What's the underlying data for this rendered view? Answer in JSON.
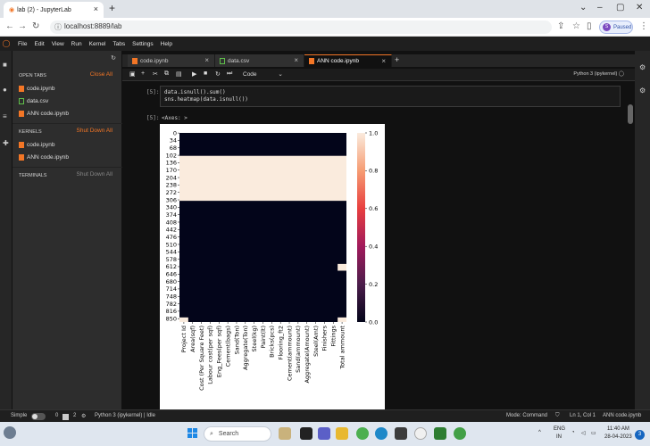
{
  "browser": {
    "tab_title": "lab (2) - JupyterLab",
    "url": "localhost:8889/lab",
    "paused_label": "Paused",
    "avatar_letter": "S"
  },
  "menu": [
    "File",
    "Edit",
    "View",
    "Run",
    "Kernel",
    "Tabs",
    "Settings",
    "Help"
  ],
  "sidebar": {
    "open_tabs_title": "OPEN TABS",
    "close_all": "Close All",
    "open_tabs": [
      "code.ipynb",
      "data.csv",
      "ANN code.ipynb"
    ],
    "kernels_title": "KERNELS",
    "shut_down_all": "Shut Down All",
    "kernels": [
      "code.ipynb",
      "ANN code.ipynb"
    ],
    "terminals_title": "TERMINALS",
    "terminals_shut_down_all": "Shut Down All"
  },
  "doc_tabs": [
    "code.ipynb",
    "data.csv",
    "ANN code.ipynb"
  ],
  "toolbar": {
    "cell_type": "Code",
    "kernel": "Python 3 (ipykernel)"
  },
  "cell": {
    "in_prompt": "[5]:",
    "code_line1": "data.isnull().sum()",
    "code_line2": "sns.heatmap(data.isnull())",
    "out_prompt": "[5]:",
    "out_text": "<Axes: >"
  },
  "chart_data": {
    "type": "heatmap",
    "y_ticks": [
      "0",
      "34",
      "68",
      "102",
      "136",
      "170",
      "204",
      "238",
      "272",
      "306",
      "340",
      "374",
      "408",
      "442",
      "476",
      "510",
      "544",
      "578",
      "612",
      "646",
      "680",
      "714",
      "748",
      "782",
      "816",
      "850"
    ],
    "x_ticks": [
      "Project Id",
      "Area(sqf)",
      "Cost (Per Square Feet)",
      "Labour cost(per sqf)",
      "Eng_Fees(per sqf)",
      "Cement(bags)",
      "Sand(Ton)",
      "Aggregate(Ton)",
      "Steel(kg)",
      "Paint(lt)",
      "Bricks(pcs)",
      "Flooring_ft2",
      "Cement(ammount)",
      "Sand(ammount)",
      "Aggregate(Amount)",
      "Steel(Amt)",
      "Finishers",
      "Fittings",
      "Total ammount"
    ],
    "colorbar_ticks": [
      "1.0",
      "0.8",
      "0.6",
      "0.4",
      "0.2",
      "0.0"
    ],
    "row_count": 866,
    "row_range": [
      0,
      865
    ],
    "missing_blocks": [
      {
        "rows": [
          105,
          310
        ],
        "columns": "all",
        "value": 1
      },
      {
        "rows": [
          600,
          630
        ],
        "columns": [
          "Total ammount"
        ],
        "value": 1
      },
      {
        "rows": [
          845,
          865
        ],
        "columns": [
          "Project Id",
          "Total ammount"
        ],
        "value": 1
      }
    ],
    "colormap": "rocket",
    "low_color": "#03051a",
    "high_color": "#faebdd",
    "vmin": 0,
    "vmax": 1
  },
  "statusbar": {
    "mode_label": "Simple",
    "count1": "0",
    "count2": "2",
    "kernel_status": "Python 3 (ipykernel) | Idle",
    "mode": "Mode: Command",
    "position": "Ln 1, Col 1",
    "file": "ANN code.ipynb"
  },
  "taskbar": {
    "search": "Search",
    "lang": "ENG",
    "region": "IN",
    "time": "11:40 AM",
    "date": "28-04-2023",
    "notifications": "3"
  }
}
